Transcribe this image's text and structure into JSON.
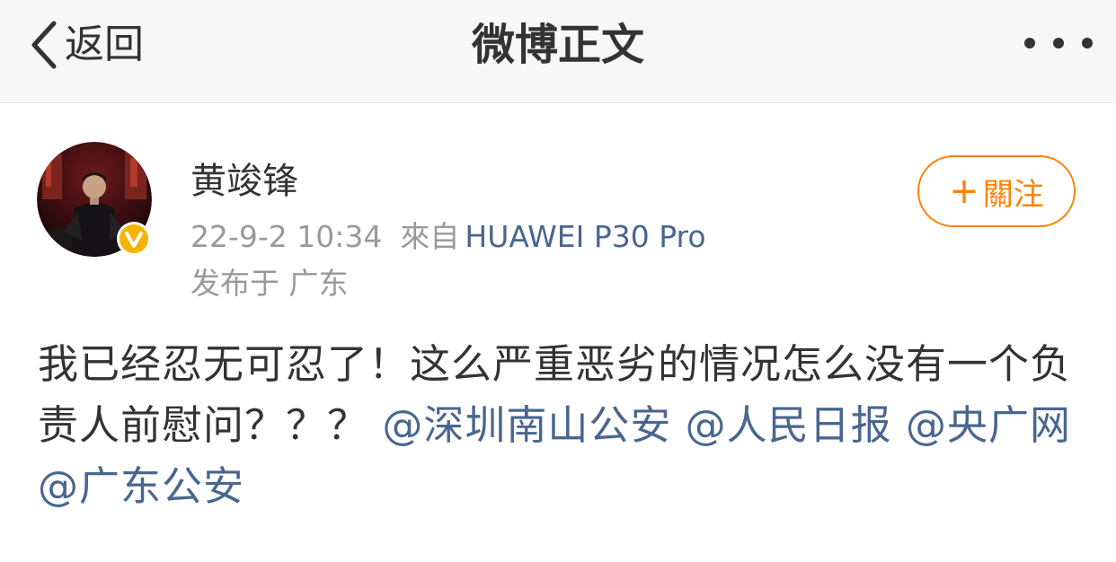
{
  "nav": {
    "back_label": "返回",
    "title": "微博正文"
  },
  "user": {
    "name": "黄竣锋",
    "time": "22-9-2 10:34",
    "source_prefix": "來自",
    "device": "HUAWEI P30 Pro",
    "location": "发布于 广东",
    "follow_label": "關注",
    "follow_plus": "+"
  },
  "post": {
    "text": "我已经忍无可忍了！这么严重恶劣的情况怎么没有一个负责人前慰问？？？",
    "mentions": [
      "@深圳南山公安",
      "@人民日报",
      "@央广网",
      "@广东公安"
    ]
  },
  "colors": {
    "accent": "#ff8200",
    "link": "#49668f",
    "verified": "#f5b400",
    "text": "#333333",
    "muted": "#999999"
  }
}
